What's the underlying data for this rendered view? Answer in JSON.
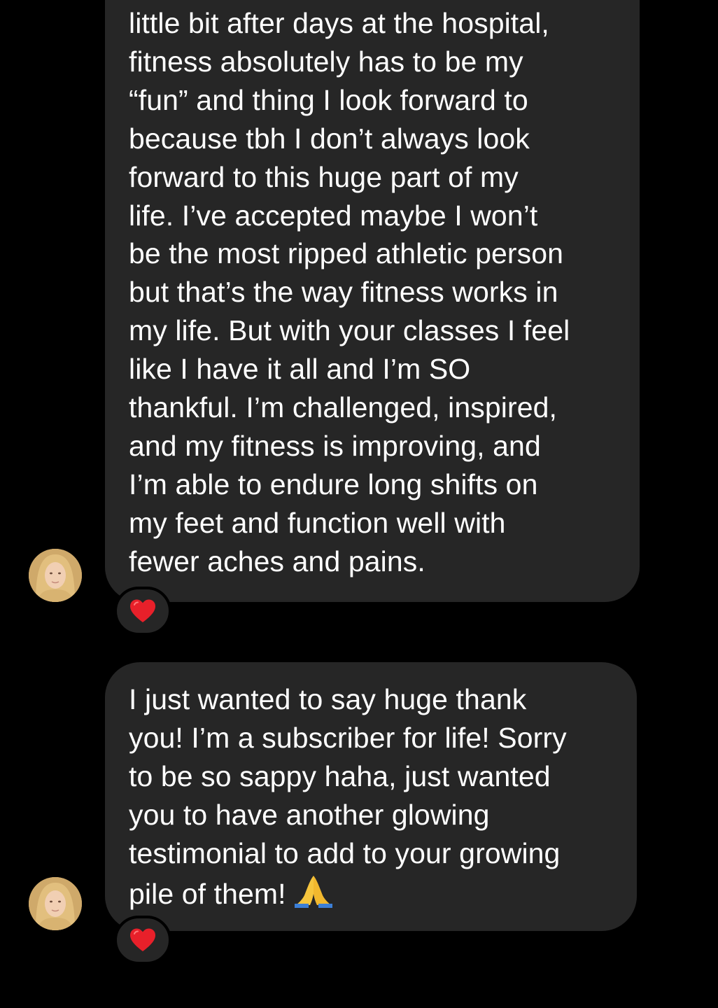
{
  "conversation": {
    "messages": [
      {
        "lines": [
          "little bit after days at the hospital,",
          "fitness absolutely has to be my",
          "“fun” and thing I look forward to",
          "because tbh I don’t always look",
          "forward to this huge part of my",
          "life. I’ve accepted maybe I won’t",
          "be the most ripped athletic person",
          "but that’s the way fitness works in",
          "my life. But with your classes I feel",
          "like I have it all and I’m SO",
          "thankful. I’m challenged, inspired,",
          "and my fitness is improving, and",
          "I’m able to endure long shifts on",
          "my feet and function well with",
          "fewer aches and pains."
        ],
        "reaction_icon": "red-heart-icon"
      },
      {
        "lines": [
          "I just wanted to say huge thank",
          "you! I’m a subscriber for life! Sorry",
          "to be so sappy haha, just wanted",
          "you to have another glowing",
          "testimonial to add to your growing",
          "pile of them!"
        ],
        "trailing_emoji": "folded-hands-icon",
        "reaction_icon": "red-heart-icon"
      }
    ]
  },
  "colors": {
    "background": "#000000",
    "bubble": "#262626",
    "text": "#ffffff",
    "heart": "#e8202a"
  }
}
